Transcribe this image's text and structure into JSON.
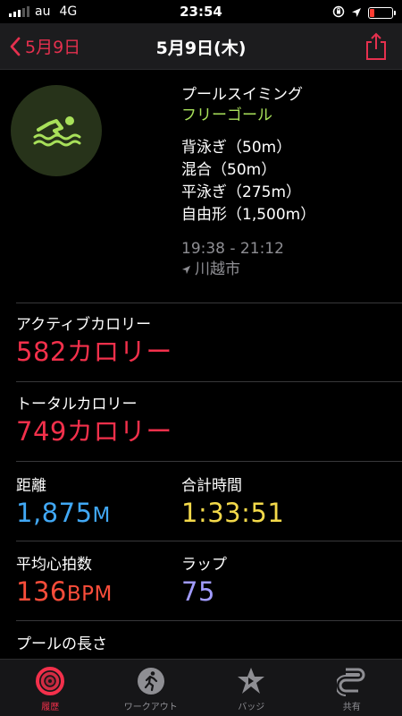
{
  "status_bar": {
    "carrier": "au",
    "network": "4G",
    "time": "23:54"
  },
  "nav": {
    "back_label": "5月9日",
    "title": "5月9日(木)"
  },
  "workout": {
    "type": "プールスイミング",
    "goal": "フリーゴール",
    "strokes": [
      "背泳ぎ（50m）",
      "混合（50m）",
      "平泳ぎ（275m）",
      "自由形（1,500m）"
    ],
    "time_range": "19:38 - 21:12",
    "location": "川越市",
    "icon": "swimmer-icon",
    "accent_color": "#a8e05a"
  },
  "metrics": {
    "active_calories": {
      "label": "アクティブカロリー",
      "value": "582カロリー"
    },
    "total_calories": {
      "label": "トータルカロリー",
      "value": "749カロリー"
    },
    "distance": {
      "label": "距離",
      "value": "1,875",
      "unit": "M"
    },
    "total_time": {
      "label": "合計時間",
      "value": "1:33:51"
    },
    "avg_heart_rate": {
      "label": "平均心拍数",
      "value": "136",
      "unit": "BPM"
    },
    "laps": {
      "label": "ラップ",
      "value": "75"
    },
    "pool_length": {
      "label": "プールの長さ"
    }
  },
  "tabs": [
    {
      "label": "履歴",
      "icon": "activity-rings-icon",
      "active": true
    },
    {
      "label": "ワークアウト",
      "icon": "runner-icon",
      "active": false
    },
    {
      "label": "バッジ",
      "icon": "award-star-icon",
      "active": false
    },
    {
      "label": "共有",
      "icon": "sharing-icon",
      "active": false
    }
  ],
  "colors": {
    "calories": "#f3304b",
    "distance": "#41a8f5",
    "time": "#f3d94a",
    "heart_rate": "#fa4d3a",
    "laps": "#a19bff"
  }
}
